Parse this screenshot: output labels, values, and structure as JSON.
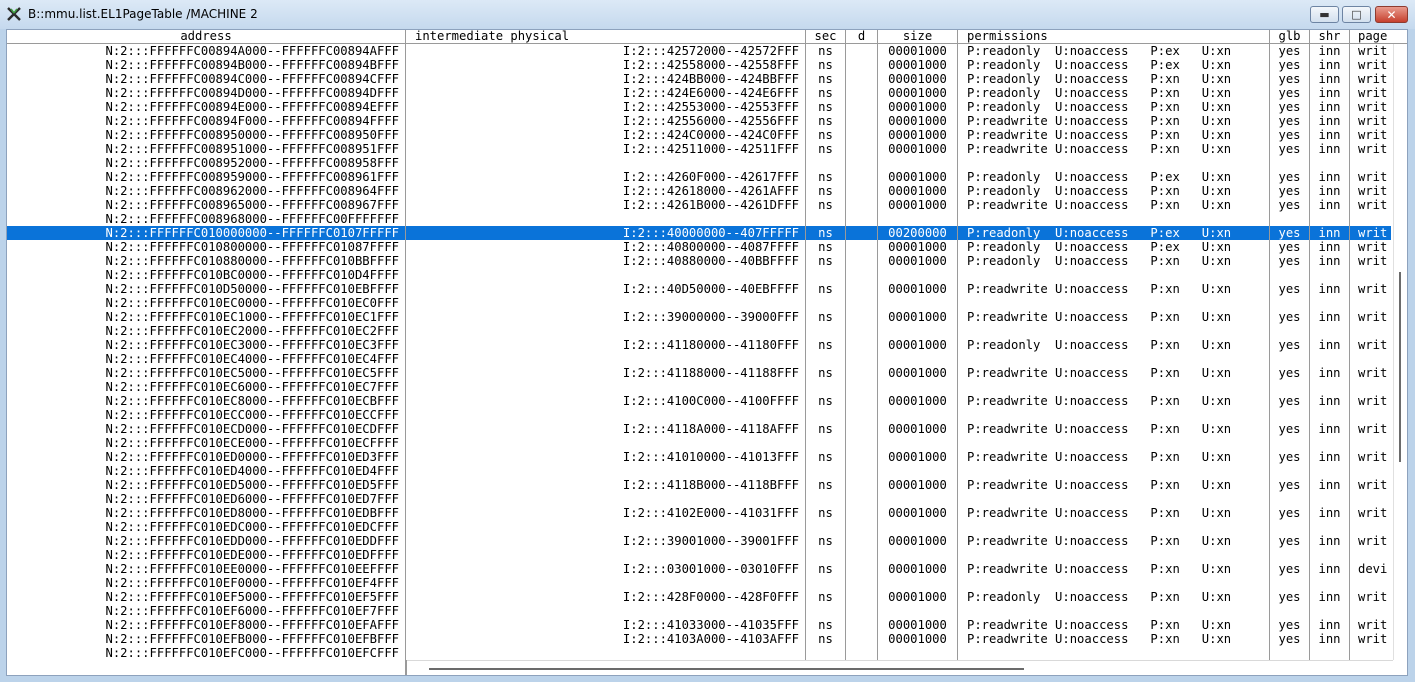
{
  "window": {
    "title": "B::mmu.list.EL1PageTable /MACHINE 2",
    "icon": "x-app-icon",
    "minimize_glyph": "▬",
    "maximize_glyph": "□",
    "close_glyph": "✕"
  },
  "columns": [
    "address",
    "intermediate physical",
    "sec",
    "d",
    "size",
    "permissions",
    "glb",
    "shr",
    "page"
  ],
  "selected_row_index": 13,
  "rows": [
    [
      "N:2:::FFFFFFC00894A000--FFFFFFC00894AFFF",
      "I:2:::42572000--42572FFF",
      "ns",
      "",
      "00001000",
      "P:readonly  U:noaccess   P:ex   U:xn",
      "yes",
      "inn",
      "writ"
    ],
    [
      "N:2:::FFFFFFC00894B000--FFFFFFC00894BFFF",
      "I:2:::42558000--42558FFF",
      "ns",
      "",
      "00001000",
      "P:readonly  U:noaccess   P:ex   U:xn",
      "yes",
      "inn",
      "writ"
    ],
    [
      "N:2:::FFFFFFC00894C000--FFFFFFC00894CFFF",
      "I:2:::424BB000--424BBFFF",
      "ns",
      "",
      "00001000",
      "P:readonly  U:noaccess   P:xn   U:xn",
      "yes",
      "inn",
      "writ"
    ],
    [
      "N:2:::FFFFFFC00894D000--FFFFFFC00894DFFF",
      "I:2:::424E6000--424E6FFF",
      "ns",
      "",
      "00001000",
      "P:readonly  U:noaccess   P:xn   U:xn",
      "yes",
      "inn",
      "writ"
    ],
    [
      "N:2:::FFFFFFC00894E000--FFFFFFC00894EFFF",
      "I:2:::42553000--42553FFF",
      "ns",
      "",
      "00001000",
      "P:readonly  U:noaccess   P:xn   U:xn",
      "yes",
      "inn",
      "writ"
    ],
    [
      "N:2:::FFFFFFC00894F000--FFFFFFC00894FFFF",
      "I:2:::42556000--42556FFF",
      "ns",
      "",
      "00001000",
      "P:readwrite U:noaccess   P:xn   U:xn",
      "yes",
      "inn",
      "writ"
    ],
    [
      "N:2:::FFFFFFC008950000--FFFFFFC008950FFF",
      "I:2:::424C0000--424C0FFF",
      "ns",
      "",
      "00001000",
      "P:readwrite U:noaccess   P:xn   U:xn",
      "yes",
      "inn",
      "writ"
    ],
    [
      "N:2:::FFFFFFC008951000--FFFFFFC008951FFF",
      "I:2:::42511000--42511FFF",
      "ns",
      "",
      "00001000",
      "P:readwrite U:noaccess   P:xn   U:xn",
      "yes",
      "inn",
      "writ"
    ],
    [
      "N:2:::FFFFFFC008952000--FFFFFFC008958FFF",
      "",
      "",
      "",
      "",
      "",
      "",
      "",
      ""
    ],
    [
      "N:2:::FFFFFFC008959000--FFFFFFC008961FFF",
      "I:2:::4260F000--42617FFF",
      "ns",
      "",
      "00001000",
      "P:readonly  U:noaccess   P:ex   U:xn",
      "yes",
      "inn",
      "writ"
    ],
    [
      "N:2:::FFFFFFC008962000--FFFFFFC008964FFF",
      "I:2:::42618000--4261AFFF",
      "ns",
      "",
      "00001000",
      "P:readonly  U:noaccess   P:xn   U:xn",
      "yes",
      "inn",
      "writ"
    ],
    [
      "N:2:::FFFFFFC008965000--FFFFFFC008967FFF",
      "I:2:::4261B000--4261DFFF",
      "ns",
      "",
      "00001000",
      "P:readwrite U:noaccess   P:xn   U:xn",
      "yes",
      "inn",
      "writ"
    ],
    [
      "N:2:::FFFFFFC008968000--FFFFFFC00FFFFFFF",
      "",
      "",
      "",
      "",
      "",
      "",
      "",
      ""
    ],
    [
      "N:2:::FFFFFFC010000000--FFFFFFC0107FFFFF",
      "I:2:::40000000--407FFFFF",
      "ns",
      "",
      "00200000",
      "P:readonly  U:noaccess   P:ex   U:xn",
      "yes",
      "inn",
      "writ"
    ],
    [
      "N:2:::FFFFFFC010800000--FFFFFFC01087FFFF",
      "I:2:::40800000--4087FFFF",
      "ns",
      "",
      "00001000",
      "P:readonly  U:noaccess   P:ex   U:xn",
      "yes",
      "inn",
      "writ"
    ],
    [
      "N:2:::FFFFFFC010880000--FFFFFFC010BBFFFF",
      "I:2:::40880000--40BBFFFF",
      "ns",
      "",
      "00001000",
      "P:readonly  U:noaccess   P:xn   U:xn",
      "yes",
      "inn",
      "writ"
    ],
    [
      "N:2:::FFFFFFC010BC0000--FFFFFFC010D4FFFF",
      "",
      "",
      "",
      "",
      "",
      "",
      "",
      ""
    ],
    [
      "N:2:::FFFFFFC010D50000--FFFFFFC010EBFFFF",
      "I:2:::40D50000--40EBFFFF",
      "ns",
      "",
      "00001000",
      "P:readwrite U:noaccess   P:xn   U:xn",
      "yes",
      "inn",
      "writ"
    ],
    [
      "N:2:::FFFFFFC010EC0000--FFFFFFC010EC0FFF",
      "",
      "",
      "",
      "",
      "",
      "",
      "",
      ""
    ],
    [
      "N:2:::FFFFFFC010EC1000--FFFFFFC010EC1FFF",
      "I:2:::39000000--39000FFF",
      "ns",
      "",
      "00001000",
      "P:readwrite U:noaccess   P:xn   U:xn",
      "yes",
      "inn",
      "writ"
    ],
    [
      "N:2:::FFFFFFC010EC2000--FFFFFFC010EC2FFF",
      "",
      "",
      "",
      "",
      "",
      "",
      "",
      ""
    ],
    [
      "N:2:::FFFFFFC010EC3000--FFFFFFC010EC3FFF",
      "I:2:::41180000--41180FFF",
      "ns",
      "",
      "00001000",
      "P:readonly  U:noaccess   P:xn   U:xn",
      "yes",
      "inn",
      "writ"
    ],
    [
      "N:2:::FFFFFFC010EC4000--FFFFFFC010EC4FFF",
      "",
      "",
      "",
      "",
      "",
      "",
      "",
      ""
    ],
    [
      "N:2:::FFFFFFC010EC5000--FFFFFFC010EC5FFF",
      "I:2:::41188000--41188FFF",
      "ns",
      "",
      "00001000",
      "P:readwrite U:noaccess   P:xn   U:xn",
      "yes",
      "inn",
      "writ"
    ],
    [
      "N:2:::FFFFFFC010EC6000--FFFFFFC010EC7FFF",
      "",
      "",
      "",
      "",
      "",
      "",
      "",
      ""
    ],
    [
      "N:2:::FFFFFFC010EC8000--FFFFFFC010ECBFFF",
      "I:2:::4100C000--4100FFFF",
      "ns",
      "",
      "00001000",
      "P:readwrite U:noaccess   P:xn   U:xn",
      "yes",
      "inn",
      "writ"
    ],
    [
      "N:2:::FFFFFFC010ECC000--FFFFFFC010ECCFFF",
      "",
      "",
      "",
      "",
      "",
      "",
      "",
      ""
    ],
    [
      "N:2:::FFFFFFC010ECD000--FFFFFFC010ECDFFF",
      "I:2:::4118A000--4118AFFF",
      "ns",
      "",
      "00001000",
      "P:readwrite U:noaccess   P:xn   U:xn",
      "yes",
      "inn",
      "writ"
    ],
    [
      "N:2:::FFFFFFC010ECE000--FFFFFFC010ECFFFF",
      "",
      "",
      "",
      "",
      "",
      "",
      "",
      ""
    ],
    [
      "N:2:::FFFFFFC010ED0000--FFFFFFC010ED3FFF",
      "I:2:::41010000--41013FFF",
      "ns",
      "",
      "00001000",
      "P:readwrite U:noaccess   P:xn   U:xn",
      "yes",
      "inn",
      "writ"
    ],
    [
      "N:2:::FFFFFFC010ED4000--FFFFFFC010ED4FFF",
      "",
      "",
      "",
      "",
      "",
      "",
      "",
      ""
    ],
    [
      "N:2:::FFFFFFC010ED5000--FFFFFFC010ED5FFF",
      "I:2:::4118B000--4118BFFF",
      "ns",
      "",
      "00001000",
      "P:readwrite U:noaccess   P:xn   U:xn",
      "yes",
      "inn",
      "writ"
    ],
    [
      "N:2:::FFFFFFC010ED6000--FFFFFFC010ED7FFF",
      "",
      "",
      "",
      "",
      "",
      "",
      "",
      ""
    ],
    [
      "N:2:::FFFFFFC010ED8000--FFFFFFC010EDBFFF",
      "I:2:::4102E000--41031FFF",
      "ns",
      "",
      "00001000",
      "P:readwrite U:noaccess   P:xn   U:xn",
      "yes",
      "inn",
      "writ"
    ],
    [
      "N:2:::FFFFFFC010EDC000--FFFFFFC010EDCFFF",
      "",
      "",
      "",
      "",
      "",
      "",
      "",
      ""
    ],
    [
      "N:2:::FFFFFFC010EDD000--FFFFFFC010EDDFFF",
      "I:2:::39001000--39001FFF",
      "ns",
      "",
      "00001000",
      "P:readwrite U:noaccess   P:xn   U:xn",
      "yes",
      "inn",
      "writ"
    ],
    [
      "N:2:::FFFFFFC010EDE000--FFFFFFC010EDFFFF",
      "",
      "",
      "",
      "",
      "",
      "",
      "",
      ""
    ],
    [
      "N:2:::FFFFFFC010EE0000--FFFFFFC010EEFFFF",
      "I:2:::03001000--03010FFF",
      "ns",
      "",
      "00001000",
      "P:readwrite U:noaccess   P:xn   U:xn",
      "yes",
      "inn",
      "devi"
    ],
    [
      "N:2:::FFFFFFC010EF0000--FFFFFFC010EF4FFF",
      "",
      "",
      "",
      "",
      "",
      "",
      "",
      ""
    ],
    [
      "N:2:::FFFFFFC010EF5000--FFFFFFC010EF5FFF",
      "I:2:::428F0000--428F0FFF",
      "ns",
      "",
      "00001000",
      "P:readonly  U:noaccess   P:xn   U:xn",
      "yes",
      "inn",
      "writ"
    ],
    [
      "N:2:::FFFFFFC010EF6000--FFFFFFC010EF7FFF",
      "",
      "",
      "",
      "",
      "",
      "",
      "",
      ""
    ],
    [
      "N:2:::FFFFFFC010EF8000--FFFFFFC010EFAFFF",
      "I:2:::41033000--41035FFF",
      "ns",
      "",
      "00001000",
      "P:readwrite U:noaccess   P:xn   U:xn",
      "yes",
      "inn",
      "writ"
    ],
    [
      "N:2:::FFFFFFC010EFB000--FFFFFFC010EFBFFF",
      "I:2:::4103A000--4103AFFF",
      "ns",
      "",
      "00001000",
      "P:readwrite U:noaccess   P:xn   U:xn",
      "yes",
      "inn",
      "writ"
    ],
    [
      "N:2:::FFFFFFC010EFC000--FFFFFFC010EFCFFF",
      "",
      "",
      "",
      "",
      "",
      "",
      "",
      ""
    ]
  ],
  "colors": {
    "selection": "#0a73d9",
    "grid_line": "#9a9a9a",
    "window_frame": "#bcd3ea"
  }
}
